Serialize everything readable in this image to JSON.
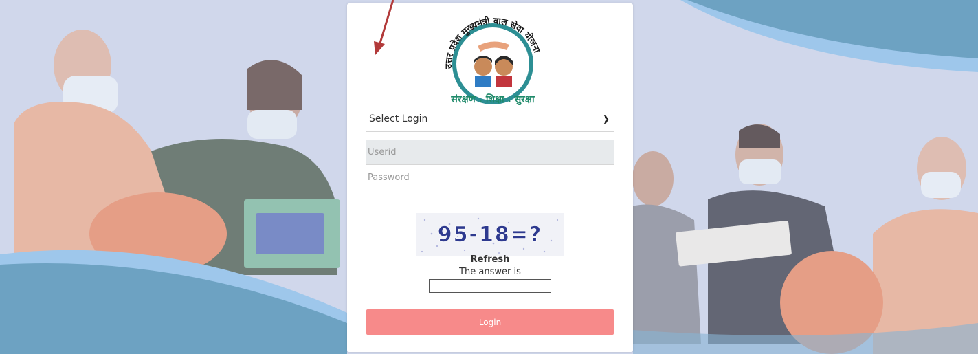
{
  "logo": {
    "arc_text": "उत्तर प्रदेश मुख्यमंत्री बाल सेवा योजना",
    "bottom_text": "संरक्षण . शिक्षा . सुरक्षा"
  },
  "form": {
    "select_login_label": "Select Login",
    "userid_placeholder": "Userid",
    "password_placeholder": "Password",
    "captcha_text": "95-18=?",
    "refresh_label": "Refresh",
    "answer_label": "The answer is",
    "login_button_label": "Login"
  },
  "colors": {
    "login_button": "#f78a8a",
    "wave_dark": "#4a8fb2",
    "wave_light": "#8ec3ea",
    "arrow": "#b23a3a"
  }
}
